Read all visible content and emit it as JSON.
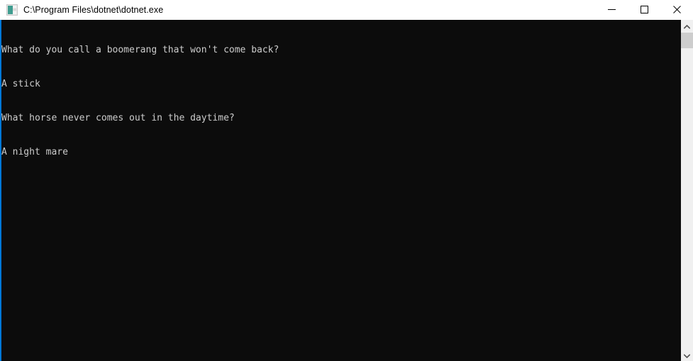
{
  "window": {
    "title": "C:\\Program Files\\dotnet\\dotnet.exe",
    "app_icon": "console-app-icon",
    "colors": {
      "titlebar_background": "#ffffff",
      "titlebar_text": "#000000",
      "console_background": "#0c0c0c",
      "console_text": "#cccccc",
      "accent_border": "#0078d7",
      "scrollbar_track": "#f0f0f0",
      "scrollbar_thumb": "#cdcdcd",
      "close_hover": "#e81123"
    }
  },
  "caption_buttons": [
    {
      "name": "minimize",
      "label": "Minimize",
      "glyph": "minimize-icon"
    },
    {
      "name": "maximize",
      "label": "Maximize",
      "glyph": "maximize-icon"
    },
    {
      "name": "close",
      "label": "Close",
      "glyph": "close-icon"
    }
  ],
  "console": {
    "lines": [
      "What do you call a boomerang that won't come back?",
      "A stick",
      "What horse never comes out in the daytime?",
      "A night mare"
    ]
  },
  "scrollbar": {
    "up_arrow": "chevron-up-icon",
    "down_arrow": "chevron-down-icon",
    "thumb_position_percent": 0,
    "orientation": "vertical"
  }
}
